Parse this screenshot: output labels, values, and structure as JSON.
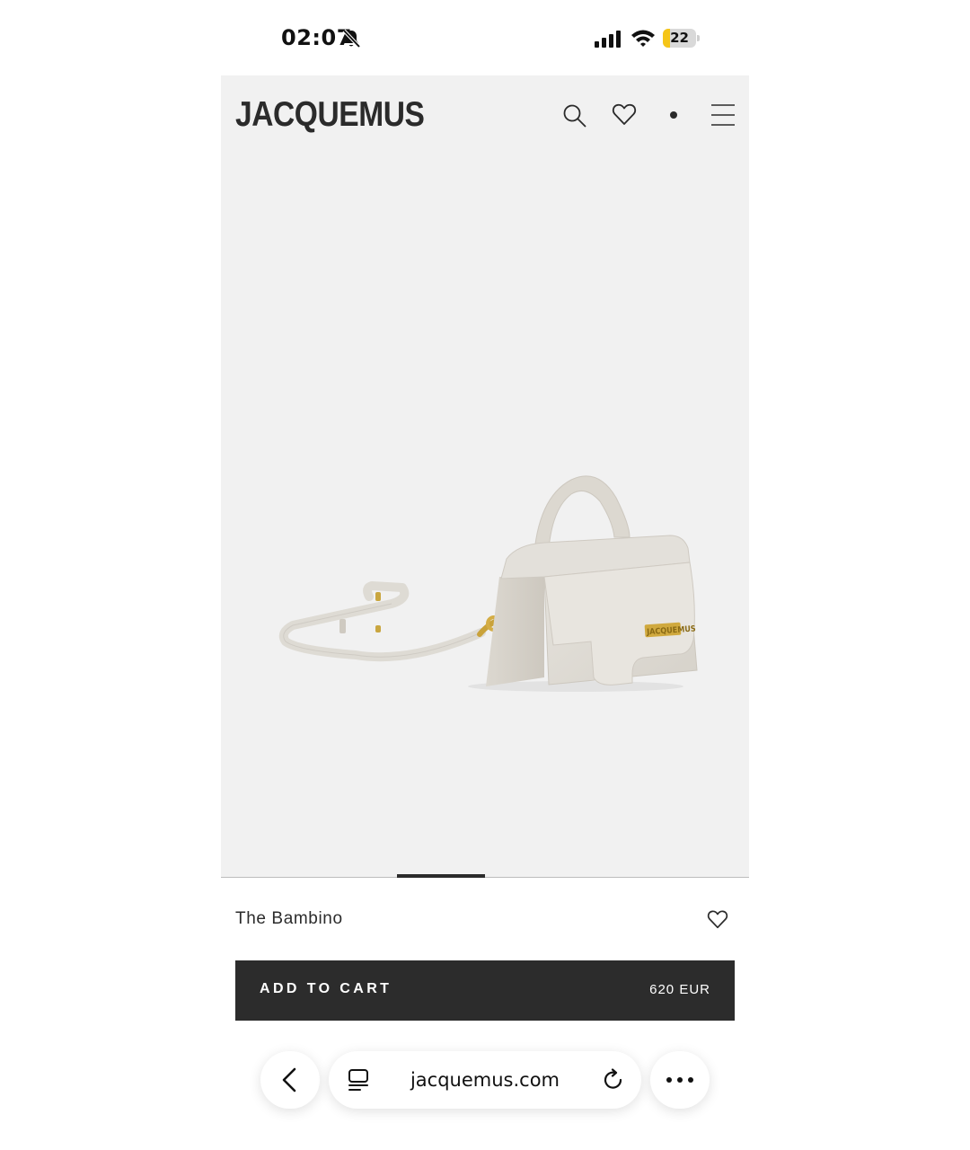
{
  "status_bar": {
    "time": "02:07",
    "battery": "22",
    "battery_level": 0.22,
    "icons": [
      "bell-slash-icon",
      "signal-icon",
      "wifi-icon",
      "battery-icon"
    ]
  },
  "header": {
    "logo": "JACQUEMUS",
    "icons": [
      "search-icon",
      "heart-icon",
      "cart-dot-icon",
      "menu-icon"
    ]
  },
  "product": {
    "name": "The Bambino",
    "image_brand_text": "JACQUEMUS",
    "add_to_cart_label": "ADD TO CART",
    "price": "620 EUR",
    "gallery_position": 0.33
  },
  "browser": {
    "url": "jacquemus.com",
    "icons": [
      "back-icon",
      "tabs-icon",
      "reload-icon",
      "more-icon"
    ]
  },
  "colors": {
    "gallery_bg": "#f1f1f1",
    "button_bg": "#2c2c2c",
    "battery_fill": "#f5c518",
    "text_dark": "#2b2b2b"
  }
}
